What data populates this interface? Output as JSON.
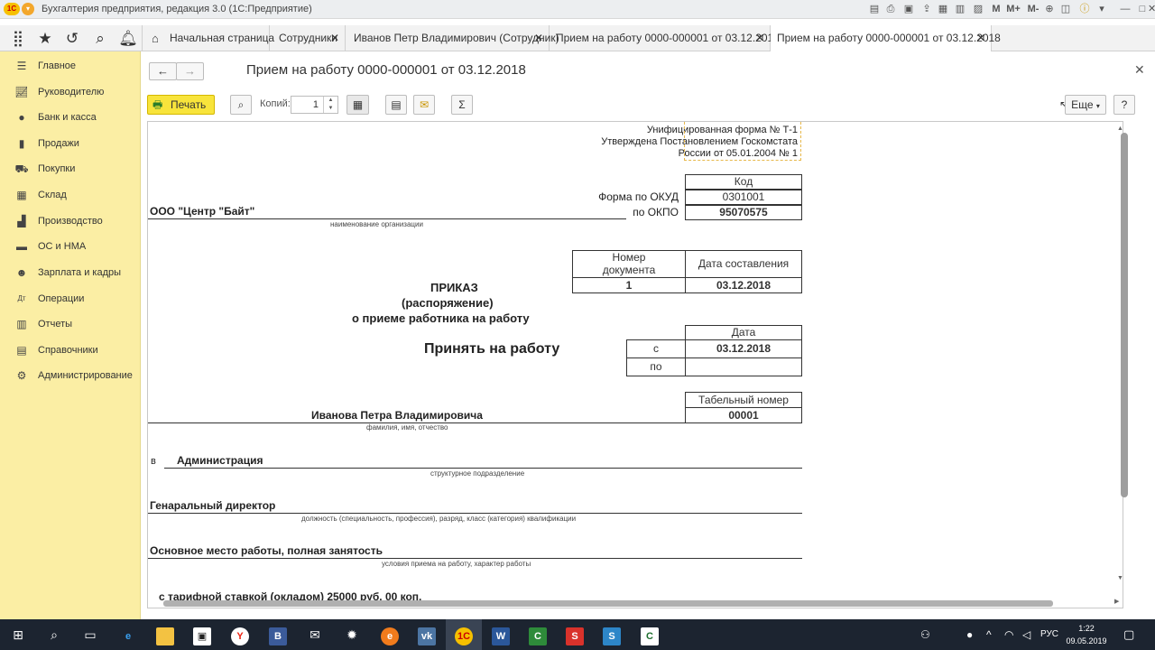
{
  "window": {
    "title": "Бухгалтерия предприятия, редакция 3.0 (1С:Предприятие)",
    "toolbar_icons": [
      "save-icon",
      "print-icon",
      "preview-icon",
      "upload-icon",
      "calendar-icon",
      "table-icon",
      "calc-icon",
      "M",
      "M+",
      "M-",
      "zoom-icon",
      "sidebar-icon",
      "info-icon",
      "menu-icon",
      "minimize-icon",
      "maximize-icon",
      "close-icon"
    ],
    "memory_labels": [
      "M",
      "M+",
      "M-"
    ]
  },
  "tabs": {
    "home": "Начальная страница",
    "items": [
      {
        "label": "Сотрудники"
      },
      {
        "label": "Иванов Петр Владимирович (Сотрудник)"
      },
      {
        "label": "Прием на работу 0000-000001 от 03.12.2018"
      },
      {
        "label": "Прием на работу 0000-000001 от 03.12.2018"
      }
    ]
  },
  "sidebar": {
    "items": [
      {
        "label": "Главное",
        "icon": "menu-icon"
      },
      {
        "label": "Руководителю",
        "icon": "chart-icon"
      },
      {
        "label": "Банк и касса",
        "icon": "coin-icon"
      },
      {
        "label": "Продажи",
        "icon": "bag-icon"
      },
      {
        "label": "Покупки",
        "icon": "cart-icon"
      },
      {
        "label": "Склад",
        "icon": "grid-icon"
      },
      {
        "label": "Производство",
        "icon": "factory-icon"
      },
      {
        "label": "ОС и НМА",
        "icon": "car-icon"
      },
      {
        "label": "Зарплата и кадры",
        "icon": "people-icon"
      },
      {
        "label": "Операции",
        "icon": "dt-kt-icon"
      },
      {
        "label": "Отчеты",
        "icon": "bar-chart-icon"
      },
      {
        "label": "Справочники",
        "icon": "book-icon"
      },
      {
        "label": "Администрирование",
        "icon": "gear-icon"
      }
    ]
  },
  "document": {
    "title": "Прием на работу 0000-000001 от 03.12.2018",
    "print_label": "Печать",
    "copies_label": "Копий:",
    "copies_value": "1",
    "more_label": "Еще",
    "help_label": "?"
  },
  "form": {
    "header_line1": "Унифицированная форма № Т-1",
    "header_line2": "Утверждена Постановлением Госкомстата",
    "header_line3": "России от 05.01.2004 № 1",
    "code_label": "Код",
    "okud_label": "Форма по ОКУД",
    "okud_value": "0301001",
    "okpo_label": "по ОКПО",
    "okpo_value": "95070575",
    "org_name": "ООО \"Центр \"Байт\"",
    "org_caption": "наименование организации",
    "docnum_label": "Номер документа",
    "docdate_label": "Дата составления",
    "docnum_value": "1",
    "docdate_value": "03.12.2018",
    "order_title1": "ПРИКАЗ",
    "order_title2": "(распоряжение)",
    "order_title3": "о приеме работника на работу",
    "hire_title": "Принять на работу",
    "date_label": "Дата",
    "from_label": "с",
    "to_label": "по",
    "from_value": "03.12.2018",
    "to_value": "",
    "tabnum_label": "Табельный номер",
    "tabnum_value": "00001",
    "employee_name": "Иванова Петра Владимировича",
    "employee_caption": "фамилия, имя, отчество",
    "in_label": "в",
    "department": "Администрация",
    "department_caption": "структурное подразделение",
    "position": "Генаральный директор",
    "position_caption": "должность (специальность, профессия), разряд, класс (категория) квалификации",
    "conditions": "Основное место работы, полная занятость",
    "conditions_caption": "условия приема на работу, характер работы",
    "salary_partial": "с тарифной ставкой (окладом)  25000 руб. 00 коп."
  },
  "taskbar": {
    "apps": [
      "windows-icon",
      "search-icon",
      "task-view-icon",
      "edge-icon",
      "explorer-icon",
      "store-icon",
      "yandex-icon",
      "B",
      "mail-icon",
      "settings-icon",
      "firefox-icon",
      "vk-icon",
      "1c-icon",
      "word-icon",
      "sheets-icon",
      "S",
      "S",
      "spreadsheet-icon"
    ],
    "lang": "РУС",
    "time": "1:22",
    "date": "09.05.2019"
  }
}
